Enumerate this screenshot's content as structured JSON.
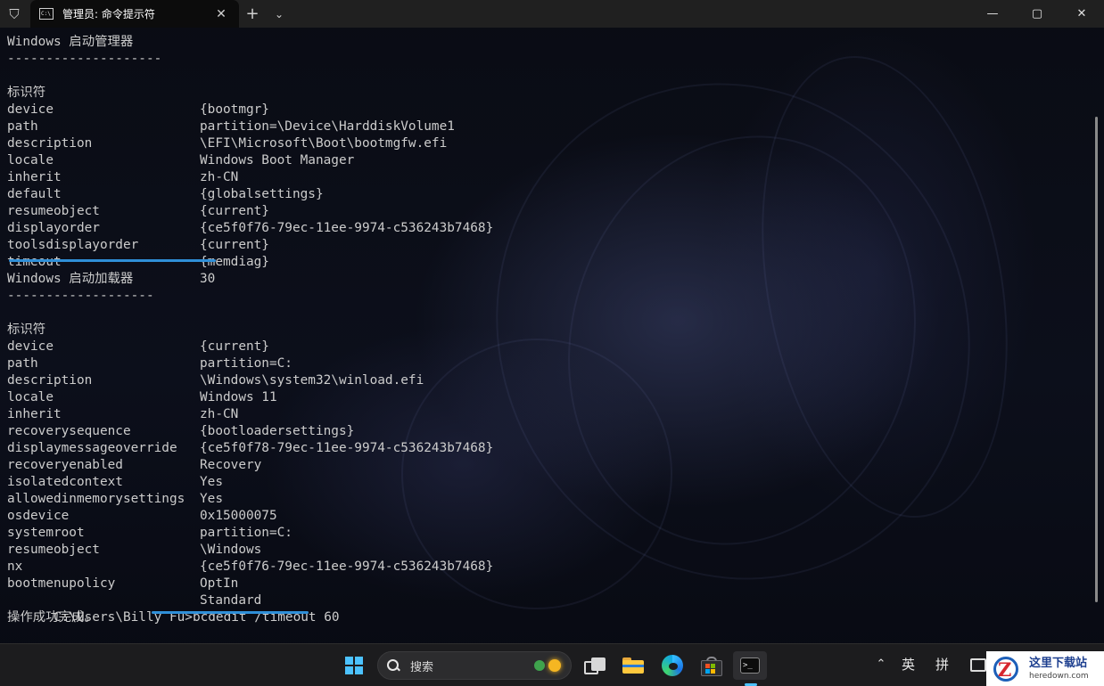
{
  "window": {
    "tab_title": "管理员: 命令提示符",
    "tab_icon_text": "C:\\",
    "tab_close": "✕",
    "new_tab": "+",
    "dropdown": "⌄",
    "minimize": "—",
    "maximize": "▢",
    "close": "✕",
    "shield_icon": "⛉"
  },
  "terminal": {
    "section1_title": "Windows 启动管理器",
    "section1_rule": "--------------------",
    "section1_entries": [
      {
        "key": "标识符",
        "value": "{bootmgr}"
      },
      {
        "key": "device",
        "value": "partition=\\Device\\HarddiskVolume1"
      },
      {
        "key": "path",
        "value": "\\EFI\\Microsoft\\Boot\\bootmgfw.efi"
      },
      {
        "key": "description",
        "value": "Windows Boot Manager"
      },
      {
        "key": "locale",
        "value": "zh-CN"
      },
      {
        "key": "inherit",
        "value": "{globalsettings}"
      },
      {
        "key": "default",
        "value": "{current}"
      },
      {
        "key": "resumeobject",
        "value": "{ce5f0f76-79ec-11ee-9974-c536243b7468}"
      },
      {
        "key": "displayorder",
        "value": "{current}"
      },
      {
        "key": "toolsdisplayorder",
        "value": "{memdiag}"
      },
      {
        "key": "timeout",
        "value": "30"
      }
    ],
    "section2_title": "Windows 启动加载器",
    "section2_rule": "-------------------",
    "section2_entries": [
      {
        "key": "标识符",
        "value": "{current}"
      },
      {
        "key": "device",
        "value": "partition=C:"
      },
      {
        "key": "path",
        "value": "\\Windows\\system32\\winload.efi"
      },
      {
        "key": "description",
        "value": "Windows 11"
      },
      {
        "key": "locale",
        "value": "zh-CN"
      },
      {
        "key": "inherit",
        "value": "{bootloadersettings}"
      },
      {
        "key": "recoverysequence",
        "value": "{ce5f0f78-79ec-11ee-9974-c536243b7468}"
      },
      {
        "key": "displaymessageoverride",
        "value": "Recovery"
      },
      {
        "key": "recoveryenabled",
        "value": "Yes"
      },
      {
        "key": "isolatedcontext",
        "value": "Yes"
      },
      {
        "key": "allowedinmemorysettings",
        "value": "0x15000075"
      },
      {
        "key": "osdevice",
        "value": "partition=C:"
      },
      {
        "key": "systemroot",
        "value": "\\Windows"
      },
      {
        "key": "resumeobject",
        "value": "{ce5f0f76-79ec-11ee-9974-c536243b7468}"
      },
      {
        "key": "nx",
        "value": "OptIn"
      },
      {
        "key": "bootmenupolicy",
        "value": "Standard"
      }
    ],
    "prompt": "C:\\Users\\Billy Fu>",
    "command": "bcdedit /timeout 60",
    "result": "操作成功完成。"
  },
  "accent_color": "#2f8fd8",
  "taskbar": {
    "search_placeholder": "搜索",
    "ime_mode": "英",
    "ime_input": "拼",
    "tray_chevron": "⌃",
    "terminal_icon_text": ">_"
  },
  "watermark": {
    "name": "这里下载站",
    "url": "heredown.com",
    "letter": "Z"
  }
}
